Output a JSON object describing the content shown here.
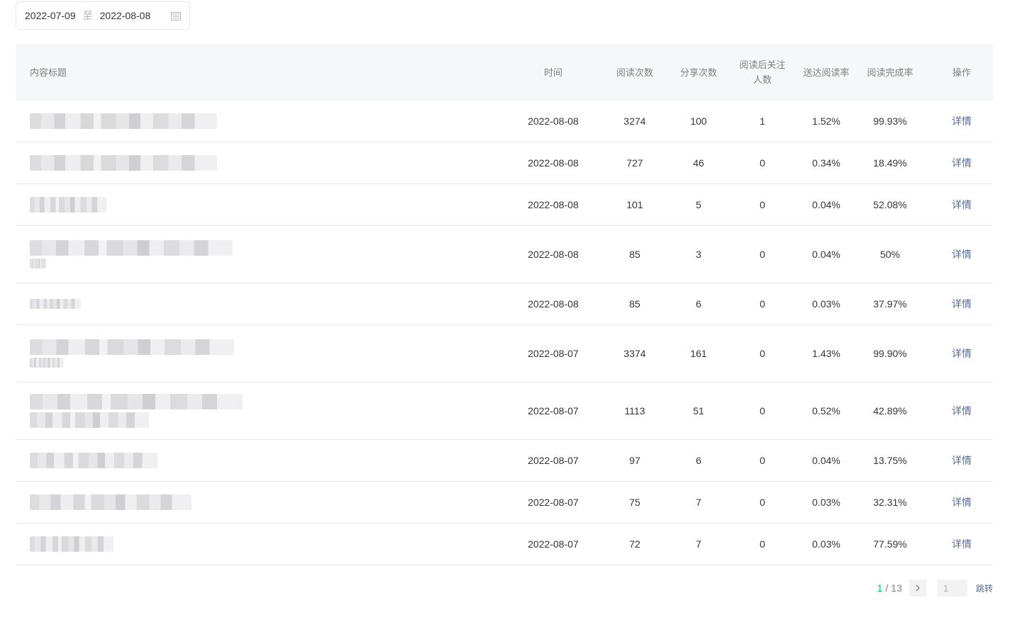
{
  "filter": {
    "start_date": "2022-07-09",
    "separator": "至",
    "end_date": "2022-08-08",
    "icon": "calendar-icon"
  },
  "table": {
    "headers": {
      "title": "内容标题",
      "time": "时间",
      "reads": "阅读次数",
      "shares": "分享次数",
      "follow_line1": "阅读后关注",
      "follow_line2": "人数",
      "delivery_rate": "送达阅读率",
      "completion_rate": "阅读完成率",
      "action": "操作"
    },
    "rows": [
      {
        "time": "2022-08-08",
        "reads": "3274",
        "shares": "100",
        "follows": "1",
        "delivery_rate": "1.52%",
        "completion_rate": "99.93%",
        "action": "详情"
      },
      {
        "time": "2022-08-08",
        "reads": "727",
        "shares": "46",
        "follows": "0",
        "delivery_rate": "0.34%",
        "completion_rate": "18.49%",
        "action": "详情"
      },
      {
        "time": "2022-08-08",
        "reads": "101",
        "shares": "5",
        "follows": "0",
        "delivery_rate": "0.04%",
        "completion_rate": "52.08%",
        "action": "详情"
      },
      {
        "time": "2022-08-08",
        "reads": "85",
        "shares": "3",
        "follows": "0",
        "delivery_rate": "0.04%",
        "completion_rate": "50%",
        "action": "详情"
      },
      {
        "time": "2022-08-08",
        "reads": "85",
        "shares": "6",
        "follows": "0",
        "delivery_rate": "0.03%",
        "completion_rate": "37.97%",
        "action": "详情"
      },
      {
        "time": "2022-08-07",
        "reads": "3374",
        "shares": "161",
        "follows": "0",
        "delivery_rate": "1.43%",
        "completion_rate": "99.90%",
        "action": "详情"
      },
      {
        "time": "2022-08-07",
        "reads": "1113",
        "shares": "51",
        "follows": "0",
        "delivery_rate": "0.52%",
        "completion_rate": "42.89%",
        "action": "详情"
      },
      {
        "time": "2022-08-07",
        "reads": "97",
        "shares": "6",
        "follows": "0",
        "delivery_rate": "0.04%",
        "completion_rate": "13.75%",
        "action": "详情"
      },
      {
        "time": "2022-08-07",
        "reads": "75",
        "shares": "7",
        "follows": "0",
        "delivery_rate": "0.03%",
        "completion_rate": "32.31%",
        "action": "详情"
      },
      {
        "time": "2022-08-07",
        "reads": "72",
        "shares": "7",
        "follows": "0",
        "delivery_rate": "0.03%",
        "completion_rate": "77.59%",
        "action": "详情"
      }
    ]
  },
  "pagination": {
    "current": "1",
    "slash": "/",
    "total": "13",
    "next_icon": "chevron-right-icon",
    "input_value": "1",
    "jump_label": "跳转"
  },
  "colors": {
    "accent_green": "#07c160",
    "link_blue": "#576b95",
    "header_bg": "#f6f7f8"
  }
}
